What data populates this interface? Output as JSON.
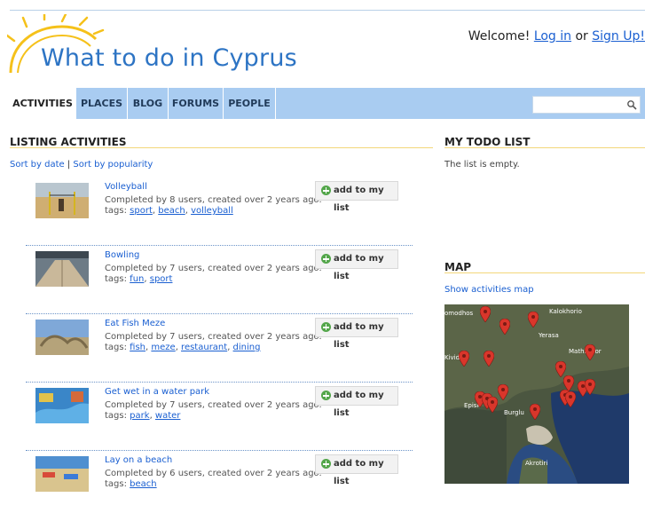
{
  "site": {
    "logo_text": "What to do in Cyprus"
  },
  "header": {
    "welcome": "Welcome!",
    "login": "Log in",
    "or": "or",
    "signup": "Sign Up!"
  },
  "nav": {
    "items": [
      "ACTIVITIES",
      "PLACES",
      "BLOG",
      "FORUMS",
      "PEOPLE"
    ],
    "active": "ACTIVITIES"
  },
  "search": {
    "value": "",
    "placeholder": ""
  },
  "listing": {
    "title": "LISTING ACTIVITIES",
    "sort_by_date": "Sort by date",
    "sort_sep": "|",
    "sort_by_popularity": "Sort by popularity",
    "add_label": "add to my list",
    "tags_label": "tags:",
    "activities": [
      {
        "name": "Volleyball",
        "meta": "Completed by 8 users, created over 2 years ago.",
        "tags": [
          "sport",
          "beach",
          "volleyball"
        ]
      },
      {
        "name": "Bowling",
        "meta": "Completed by 7 users, created over 2 years ago.",
        "tags": [
          "fun",
          "sport"
        ]
      },
      {
        "name": "Eat Fish Meze",
        "meta": "Completed by 7 users, created over 2 years ago.",
        "tags": [
          "fish",
          "meze",
          "restaurant",
          "dining"
        ]
      },
      {
        "name": "Get wet in a water park",
        "meta": "Completed by 7 users, created over 2 years ago.",
        "tags": [
          "park",
          "water"
        ]
      },
      {
        "name": "Lay on a beach",
        "meta": "Completed by 6 users, created over 2 years ago.",
        "tags": [
          "beach"
        ]
      }
    ]
  },
  "todo": {
    "title": "MY TODO LIST",
    "empty": "The list is empty."
  },
  "map": {
    "title": "MAP",
    "show_link": "Show activities map",
    "labels": [
      "omodhos",
      "Kalokhorio",
      "Yerasa",
      "Mathikolor",
      "Kividhi",
      "Episk",
      "Burglu",
      "Akrotiri"
    ]
  },
  "colors": {
    "accent": "#1a5fd1",
    "nav_bg": "#a9ccf1",
    "section_rule": "#f3d77a",
    "logo_sun": "#f5c11a"
  }
}
